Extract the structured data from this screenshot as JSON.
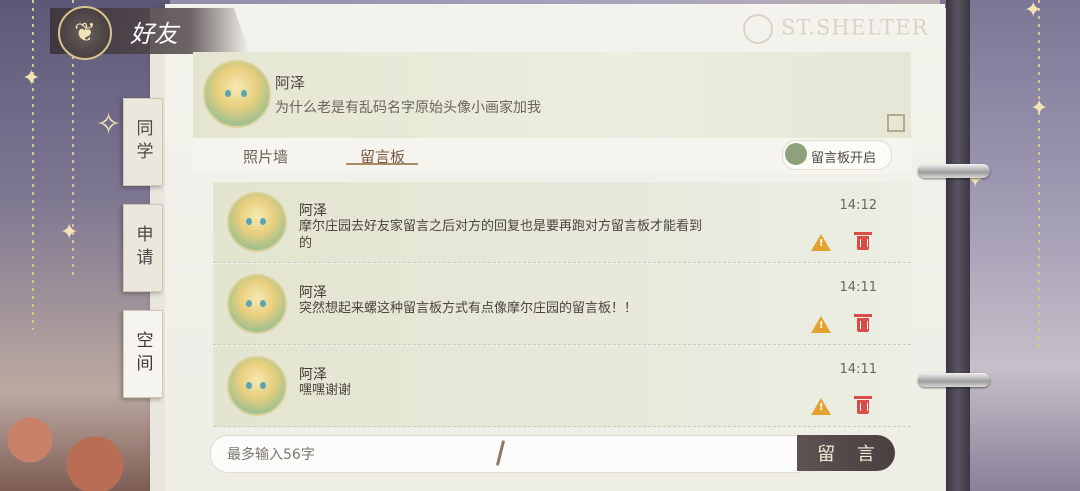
{
  "app": {
    "title": "好友",
    "logo_text": "ST.SHELTER"
  },
  "side_tabs": [
    {
      "label": "同学",
      "active": false
    },
    {
      "label": "申请",
      "active": false
    },
    {
      "label": "空间",
      "active": true
    }
  ],
  "profile": {
    "name": "阿泽",
    "signature": "为什么老是有乱码名字原始头像小画家加我"
  },
  "tabs": [
    {
      "label": "照片墙",
      "active": false
    },
    {
      "label": "留言板",
      "active": true
    }
  ],
  "toggle": {
    "label": "留言板开启",
    "on": true
  },
  "messages": [
    {
      "name": "阿泽",
      "text": "摩尔庄园去好友家留言之后对方的回复也是要再跑对方留言板才能看到的",
      "time": "14:12"
    },
    {
      "name": "阿泽",
      "text": "突然想起来螺这种留言板方式有点像摩尔庄园的留言板！！",
      "time": "14:11"
    },
    {
      "name": "阿泽",
      "text": "嘿嘿谢谢",
      "time": "14:11"
    }
  ],
  "input": {
    "placeholder": "最多输入56字",
    "value": ""
  },
  "submit_label": "留 言",
  "colors": {
    "accent": "#7b5c44",
    "toggle_on": "#8da27c",
    "warning": "#e2a32e",
    "delete": "#d94c48"
  }
}
